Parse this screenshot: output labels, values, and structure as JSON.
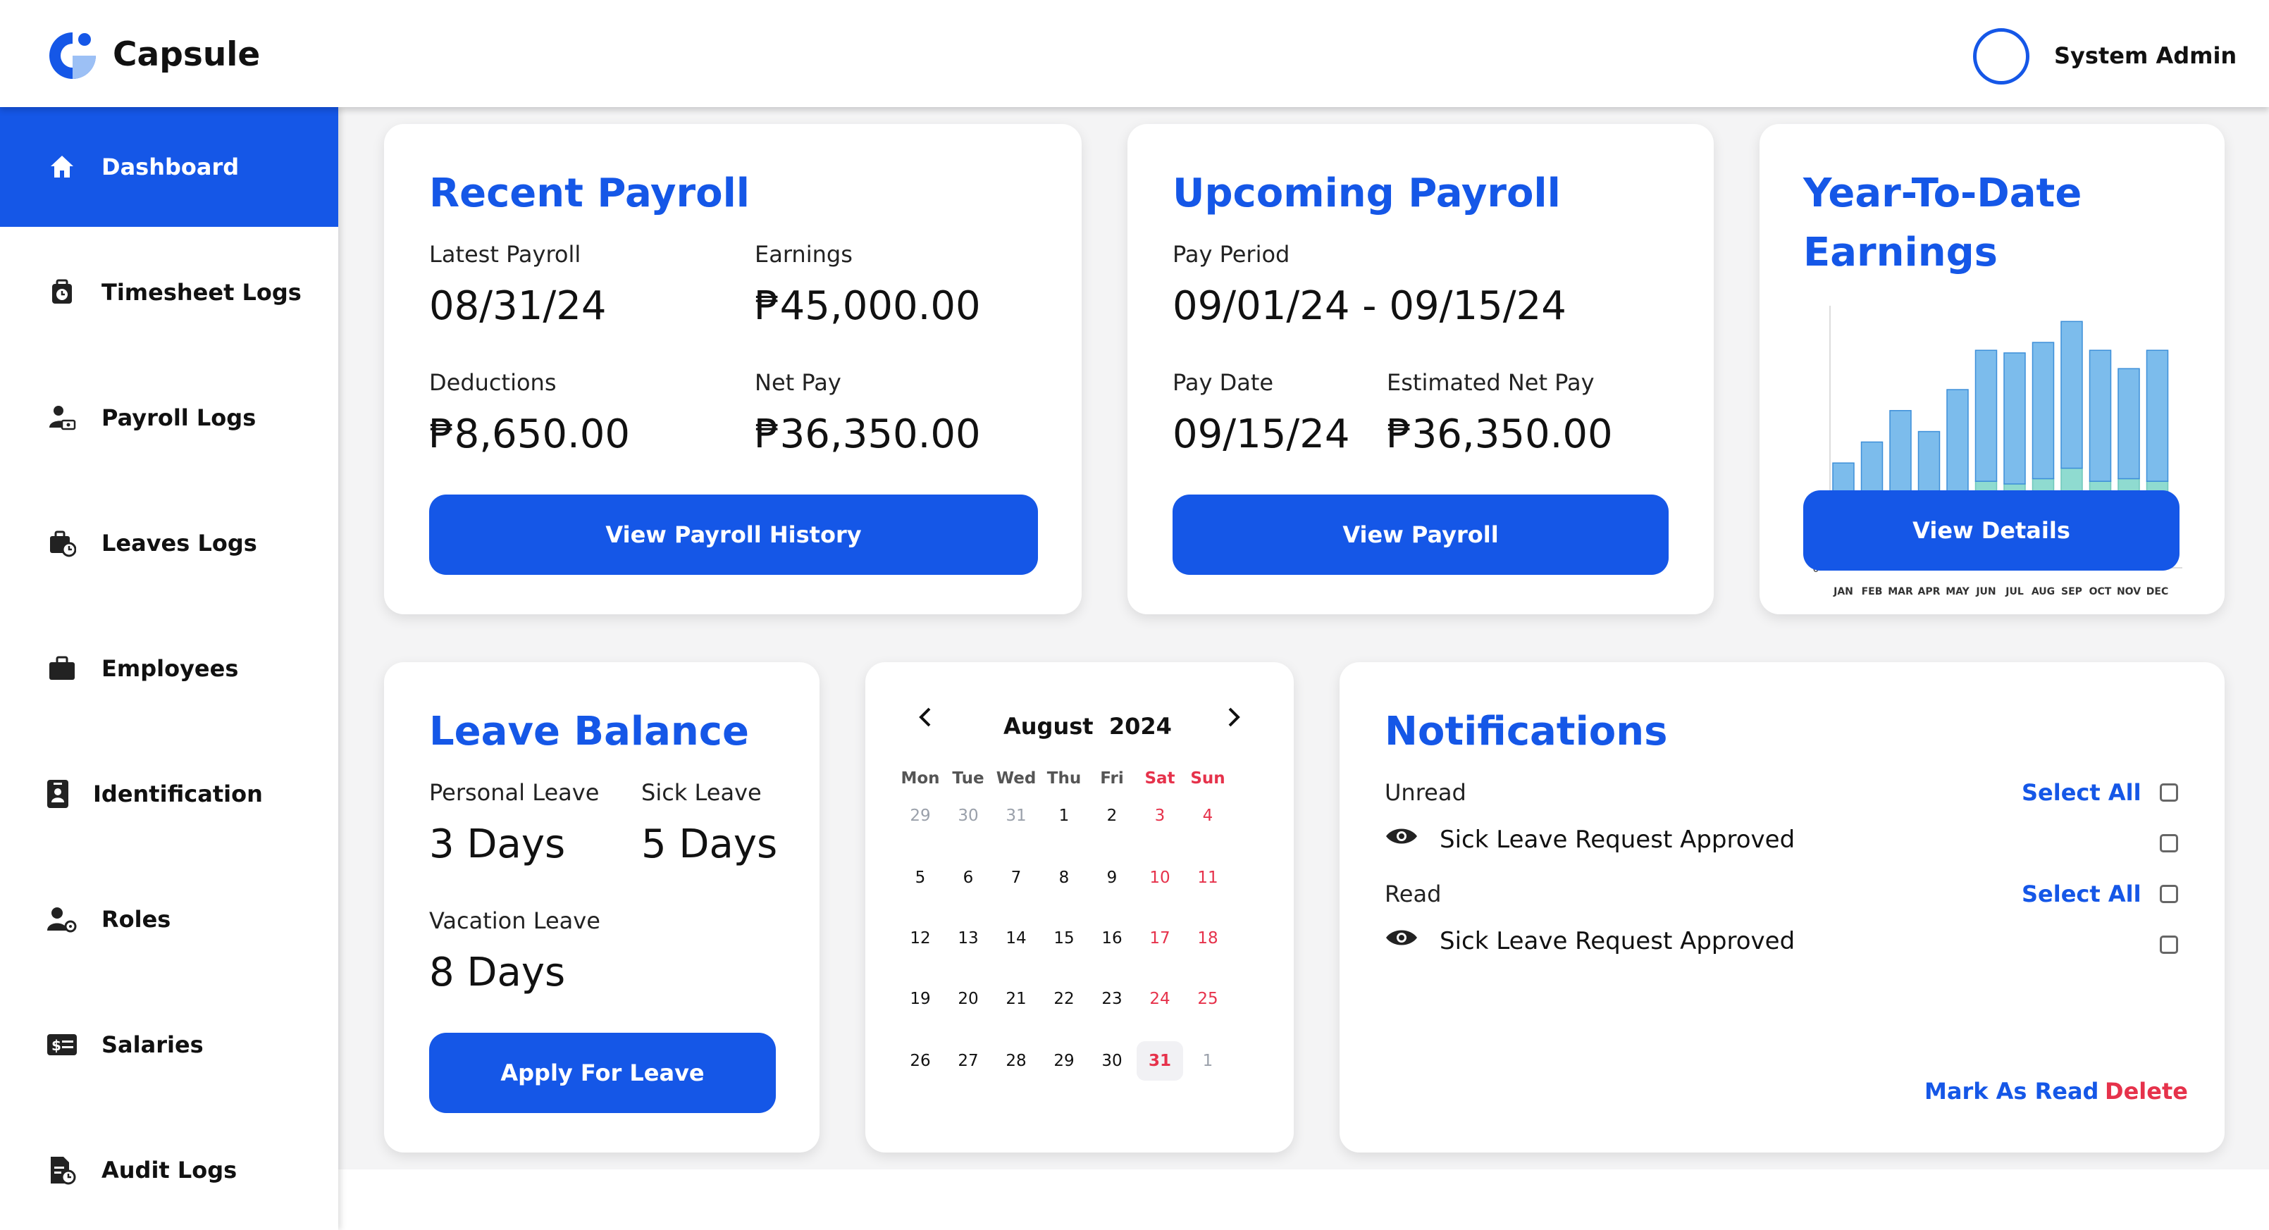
{
  "header": {
    "app_name": "Capsule",
    "user_name": "System Admin"
  },
  "colors": {
    "accent": "#1557e7",
    "danger": "#e6324b",
    "chart_top": "#7cbcec",
    "chart_bottom": "#8fdbd0"
  },
  "sidebar": {
    "items": [
      {
        "label": "Dashboard",
        "icon": "home-icon",
        "active": true
      },
      {
        "label": "Timesheet Logs",
        "icon": "clock-bag-icon"
      },
      {
        "label": "Payroll Logs",
        "icon": "user-money-icon"
      },
      {
        "label": "Leaves Logs",
        "icon": "briefcase-clock-icon"
      },
      {
        "label": "Employees",
        "icon": "briefcase-icon"
      },
      {
        "label": "Identification",
        "icon": "id-badge-icon"
      },
      {
        "label": "Roles",
        "icon": "user-gear-icon"
      },
      {
        "label": "Salaries",
        "icon": "money-card-icon"
      },
      {
        "label": "Audit Logs",
        "icon": "document-clock-icon"
      }
    ]
  },
  "recent_payroll": {
    "title": "Recent Payroll",
    "latest_label": "Latest Payroll",
    "latest_value": "08/31/24",
    "earnings_label": "Earnings",
    "earnings_value": "₱45,000.00",
    "deductions_label": "Deductions",
    "deductions_value": "₱8,650.00",
    "net_label": "Net Pay",
    "net_value": "₱36,350.00",
    "button": "View Payroll History"
  },
  "upcoming_payroll": {
    "title": "Upcoming Payroll",
    "period_label": "Pay Period",
    "period_value": "09/01/24 - 09/15/24",
    "date_label": "Pay Date",
    "date_value": "09/15/24",
    "net_label": "Estimated Net Pay",
    "net_value": "₱36,350.00",
    "button": "View Payroll"
  },
  "ytd": {
    "title_line1": "Year-To-Date",
    "title_line2": "Earnings",
    "button": "View Details"
  },
  "chart_data": {
    "type": "bar",
    "stacked": true,
    "categories": [
      "JAN",
      "FEB",
      "MAR",
      "APR",
      "MAY",
      "JUN",
      "JUL",
      "AUG",
      "SEP",
      "OCT",
      "NOV",
      "DEC"
    ],
    "series": [
      {
        "values": [
          20,
          22,
          26,
          24,
          28,
          33,
          32,
          34,
          38,
          33,
          34,
          33
        ]
      },
      {
        "values": [
          20,
          26,
          34,
          28,
          40,
          50,
          50,
          52,
          56,
          50,
          42,
          50
        ]
      }
    ],
    "ytick_labels": [
      "0"
    ],
    "ylim": [
      0,
      100
    ],
    "grid": true
  },
  "leave_balance": {
    "title": "Leave Balance",
    "personal_label": "Personal Leave",
    "personal_value": "3 Days",
    "sick_label": "Sick Leave",
    "sick_value": "5 Days",
    "vacation_label": "Vacation Leave",
    "vacation_value": "8 Days",
    "button": "Apply For Leave"
  },
  "calendar": {
    "month_year": "August  2024",
    "weekdays": [
      "Mon",
      "Tue",
      "Wed",
      "Thu",
      "Fri",
      "Sat",
      "Sun"
    ],
    "weeks": [
      [
        "29",
        "30",
        "31",
        "1",
        "2",
        "3",
        "4"
      ],
      [
        "5",
        "6",
        "7",
        "8",
        "9",
        "10",
        "11"
      ],
      [
        "12",
        "13",
        "14",
        "15",
        "16",
        "17",
        "18"
      ],
      [
        "19",
        "20",
        "21",
        "22",
        "23",
        "24",
        "25"
      ],
      [
        "26",
        "27",
        "28",
        "29",
        "30",
        "31",
        "1"
      ]
    ],
    "selected_day": "31"
  },
  "notifications": {
    "title": "Notifications",
    "unread_label": "Unread",
    "read_label": "Read",
    "select_all": "Select All",
    "unread_items": [
      "Sick Leave Request Approved"
    ],
    "read_items": [
      "Sick Leave Request Approved"
    ],
    "mark_as_read": "Mark As Read",
    "delete": "Delete"
  }
}
